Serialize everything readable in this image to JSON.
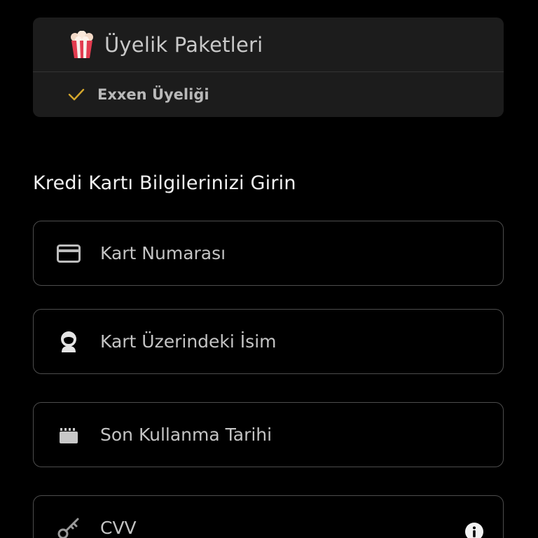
{
  "packages": {
    "title": "Üyelik Paketleri",
    "icon": "popcorn-icon",
    "items": [
      {
        "label": "Exxen Üyeliği",
        "icon": "check-icon",
        "check_color": "#d4a72c"
      }
    ]
  },
  "form": {
    "title": "Kredi Kartı Bilgilerinizi Girin",
    "fields": {
      "card_number": {
        "placeholder": "Kart Numarası",
        "value": "",
        "icon": "credit-card-icon"
      },
      "card_name": {
        "placeholder": "Kart Üzerindeki İsim",
        "value": "",
        "icon": "person-icon"
      },
      "expiry": {
        "placeholder": "Son Kullanma Tarihi",
        "value": "",
        "icon": "calendar-icon"
      },
      "cvv": {
        "placeholder": "CVV",
        "value": "",
        "icon": "key-icon",
        "info_icon": "info-icon"
      }
    }
  },
  "colors": {
    "background": "#000000",
    "card_background": "#1c1c1c",
    "border": "#4d4d4d",
    "accent": "#d4a72c"
  }
}
